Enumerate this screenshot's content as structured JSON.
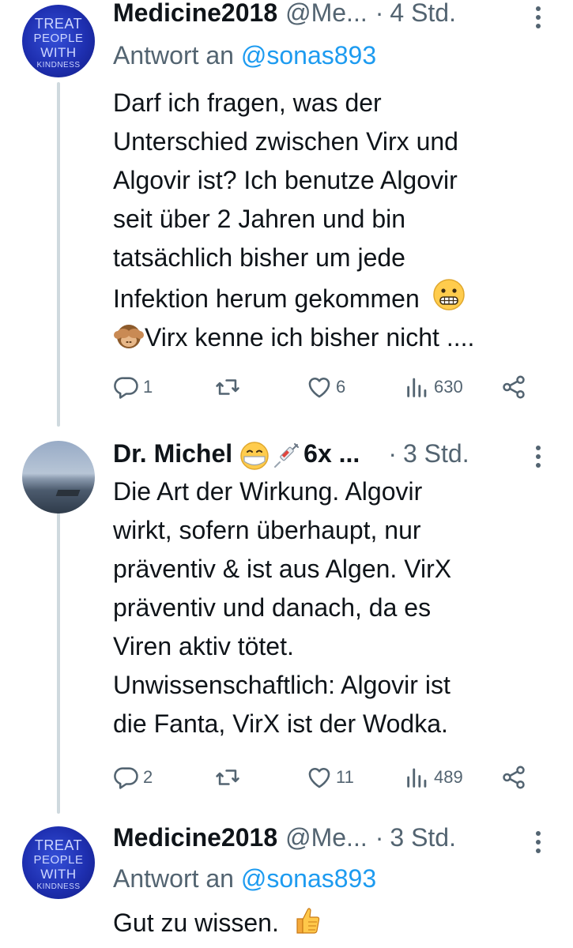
{
  "tweets": [
    {
      "avatar": {
        "lines": [
          "TREAT",
          "PEOPLE",
          "WITH",
          "KINDNESS"
        ]
      },
      "name": "Medicine2018",
      "handle": "@Me...",
      "separator": "·",
      "time": "4 Std.",
      "reply_prefix": "Antwort an",
      "reply_handle": "@sonas893",
      "lines": [
        "Darf ich fragen, was der",
        "Unterschied zwischen Virx und",
        "Algovir ist? Ich benutze Algovir",
        "seit über 2 Jahren und bin",
        "tatsächlich bisher um jede",
        "Infektion herum gekommen",
        "Virx kenne ich bisher nicht ...."
      ],
      "emojis": [
        "grimacing-face",
        "see-no-evil-monkey"
      ],
      "counts": {
        "replies": "1",
        "retweets": "",
        "likes": "6",
        "views": "630"
      }
    },
    {
      "name": "Dr. Michel",
      "name_suffix": "6x ...",
      "name_emojis": [
        "face-with-medical-mask",
        "syringe"
      ],
      "separator": "·",
      "time": "3 Std.",
      "lines": [
        "Die Art der Wirkung. Algovir",
        "wirkt, sofern überhaupt, nur",
        "präventiv & ist aus Algen. VirX",
        "präventiv und danach, da es",
        "Viren aktiv tötet.",
        "Unwissenschaftlich: Algovir ist",
        "die Fanta, VirX ist der Wodka."
      ],
      "counts": {
        "replies": "2",
        "retweets": "",
        "likes": "11",
        "views": "489"
      }
    },
    {
      "avatar": {
        "lines": [
          "TREAT",
          "PEOPLE",
          "WITH",
          "KINDNESS"
        ]
      },
      "name": "Medicine2018",
      "handle": "@Me...",
      "separator": "·",
      "time": "3 Std.",
      "reply_prefix": "Antwort an",
      "reply_handle": "@sonas893",
      "lines": [
        "Gut zu wissen."
      ],
      "emojis": [
        "thumbs-up"
      ]
    }
  ],
  "icons": {
    "reply": "reply-icon",
    "retweet": "retweet-icon",
    "like": "heart-icon",
    "views": "views-icon",
    "share": "share-icon",
    "more": "more-options-icon"
  },
  "colors": {
    "text": "#0f1419",
    "secondary": "#536471",
    "link": "#1d9bf0",
    "thread_line": "#cfd9de"
  }
}
